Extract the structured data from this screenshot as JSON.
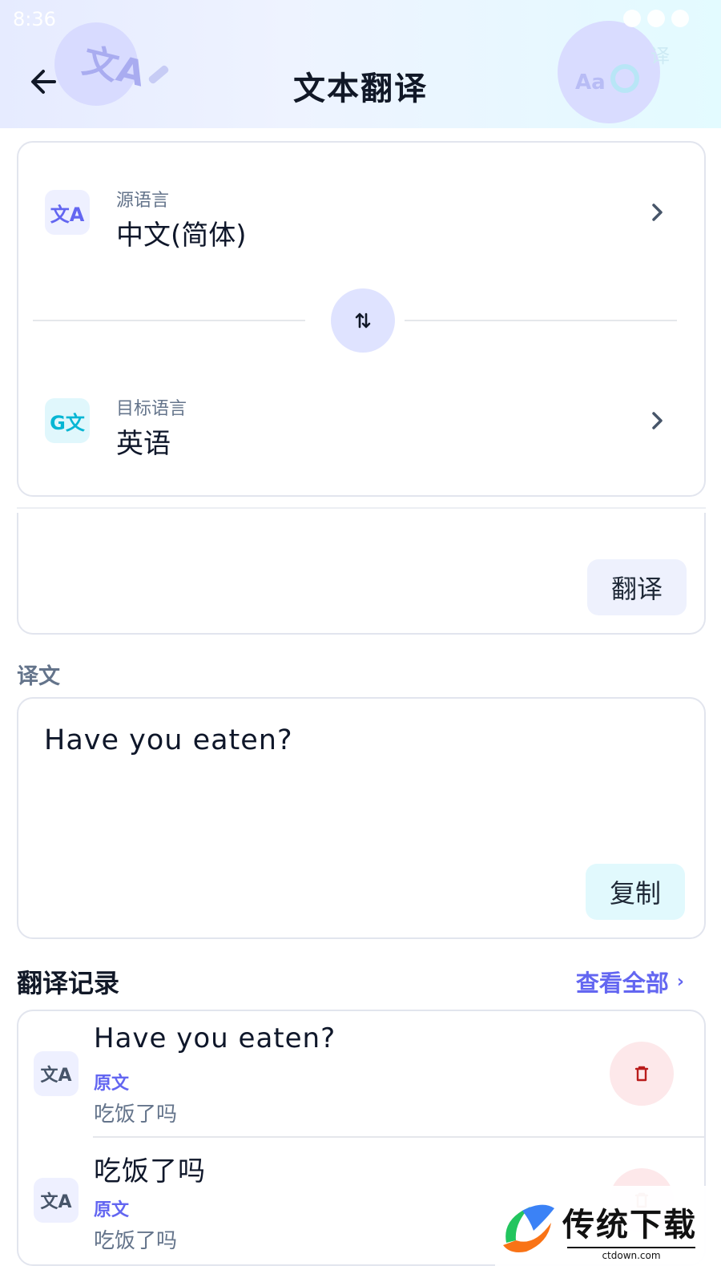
{
  "status_bar": {
    "time": "8:36"
  },
  "header": {
    "title": "文本翻译",
    "deco_translate_glyph": "文A",
    "deco_aa": "Aa",
    "deco_partial_char": "译"
  },
  "languages": {
    "source": {
      "label": "源语言",
      "value": "中文(简体)",
      "icon_text": "文A"
    },
    "target": {
      "label": "目标语言",
      "value": "英语",
      "icon_text": "G文"
    }
  },
  "input": {
    "translate_label": "翻译"
  },
  "result": {
    "section_label": "译文",
    "text": "Have you eaten?",
    "copy_label": "复制"
  },
  "history": {
    "title": "翻译记录",
    "view_all_label": "查看全部",
    "items": [
      {
        "main": "Have you eaten?",
        "tag": "原文",
        "original": "吃饭了吗",
        "icon_text": "文A"
      },
      {
        "main": "吃饭了吗",
        "tag": "原文",
        "original": "吃饭了吗",
        "icon_text": "文A"
      }
    ]
  },
  "watermark": {
    "text": "传统下载",
    "sub": "ctdown.com"
  },
  "colors": {
    "accent": "#6366f1",
    "cyan": "#06b6d4",
    "danger": "#b91c1c"
  }
}
